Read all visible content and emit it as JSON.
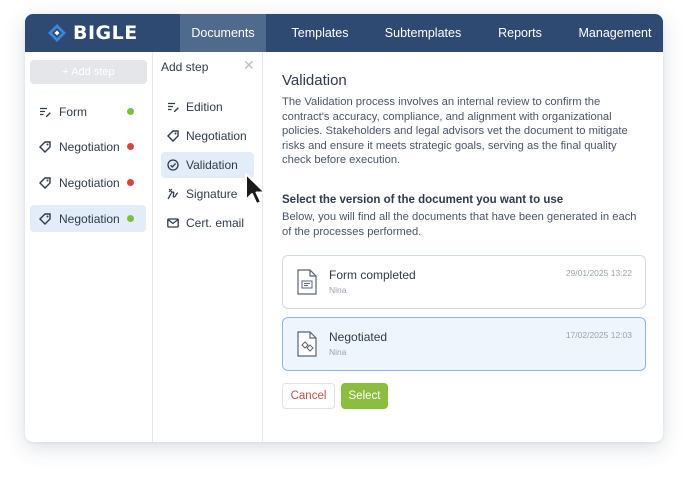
{
  "app": {
    "logo_text": "BIGLE",
    "brand_color": "#2e4a73",
    "accent_color": "#8bbd3f"
  },
  "nav": {
    "items": [
      {
        "label": "Documents",
        "active": true
      },
      {
        "label": "Templates"
      },
      {
        "label": "Subtemplates"
      },
      {
        "label": "Reports"
      },
      {
        "label": "Management"
      }
    ]
  },
  "steps_panel": {
    "add_step_label": "+ Add step",
    "steps": [
      {
        "label": "Form",
        "icon": "form-icon",
        "status_color": "#7cbf3a"
      },
      {
        "label": "Negotiation",
        "icon": "tag-icon",
        "status_color": "#d9443c"
      },
      {
        "label": "Negotiation",
        "icon": "tag-icon",
        "status_color": "#d9443c"
      },
      {
        "label": "Negotiation",
        "icon": "tag-icon",
        "status_color": "#7cbf3a",
        "selected": true
      }
    ]
  },
  "add_step_panel": {
    "title": "Add step",
    "close_icon": "close-icon",
    "items": [
      {
        "label": "Edition",
        "icon": "edit-icon"
      },
      {
        "label": "Negotiation",
        "icon": "tag-icon"
      },
      {
        "label": "Validation",
        "icon": "check-circle-icon",
        "selected": true
      },
      {
        "label": "Signature",
        "icon": "signature-icon"
      },
      {
        "label": "Cert. email",
        "icon": "mail-icon"
      }
    ]
  },
  "main": {
    "title": "Validation",
    "description": "The Validation process involves an internal review to confirm the contract's accuracy, compliance, and alignment with organizational policies. Stakeholders and legal advisors vet the document to mitigate risks and ensure it meets strategic goals, serving as the final quality check before execution.",
    "select_title": "Select the version of the document you want to use",
    "select_description": "Below, you will find all the documents that have been generated in each of the processes performed.",
    "documents": [
      {
        "name": "Form completed",
        "user": "Nina",
        "date": "29/01/2025 13:22",
        "icon": "form-doc-icon"
      },
      {
        "name": "Negotiated",
        "user": "Nina",
        "date": "17/02/2025 12:03",
        "icon": "negotiation-doc-icon",
        "selected": true
      }
    ],
    "cancel_label": "Cancel",
    "select_label": "Select"
  }
}
